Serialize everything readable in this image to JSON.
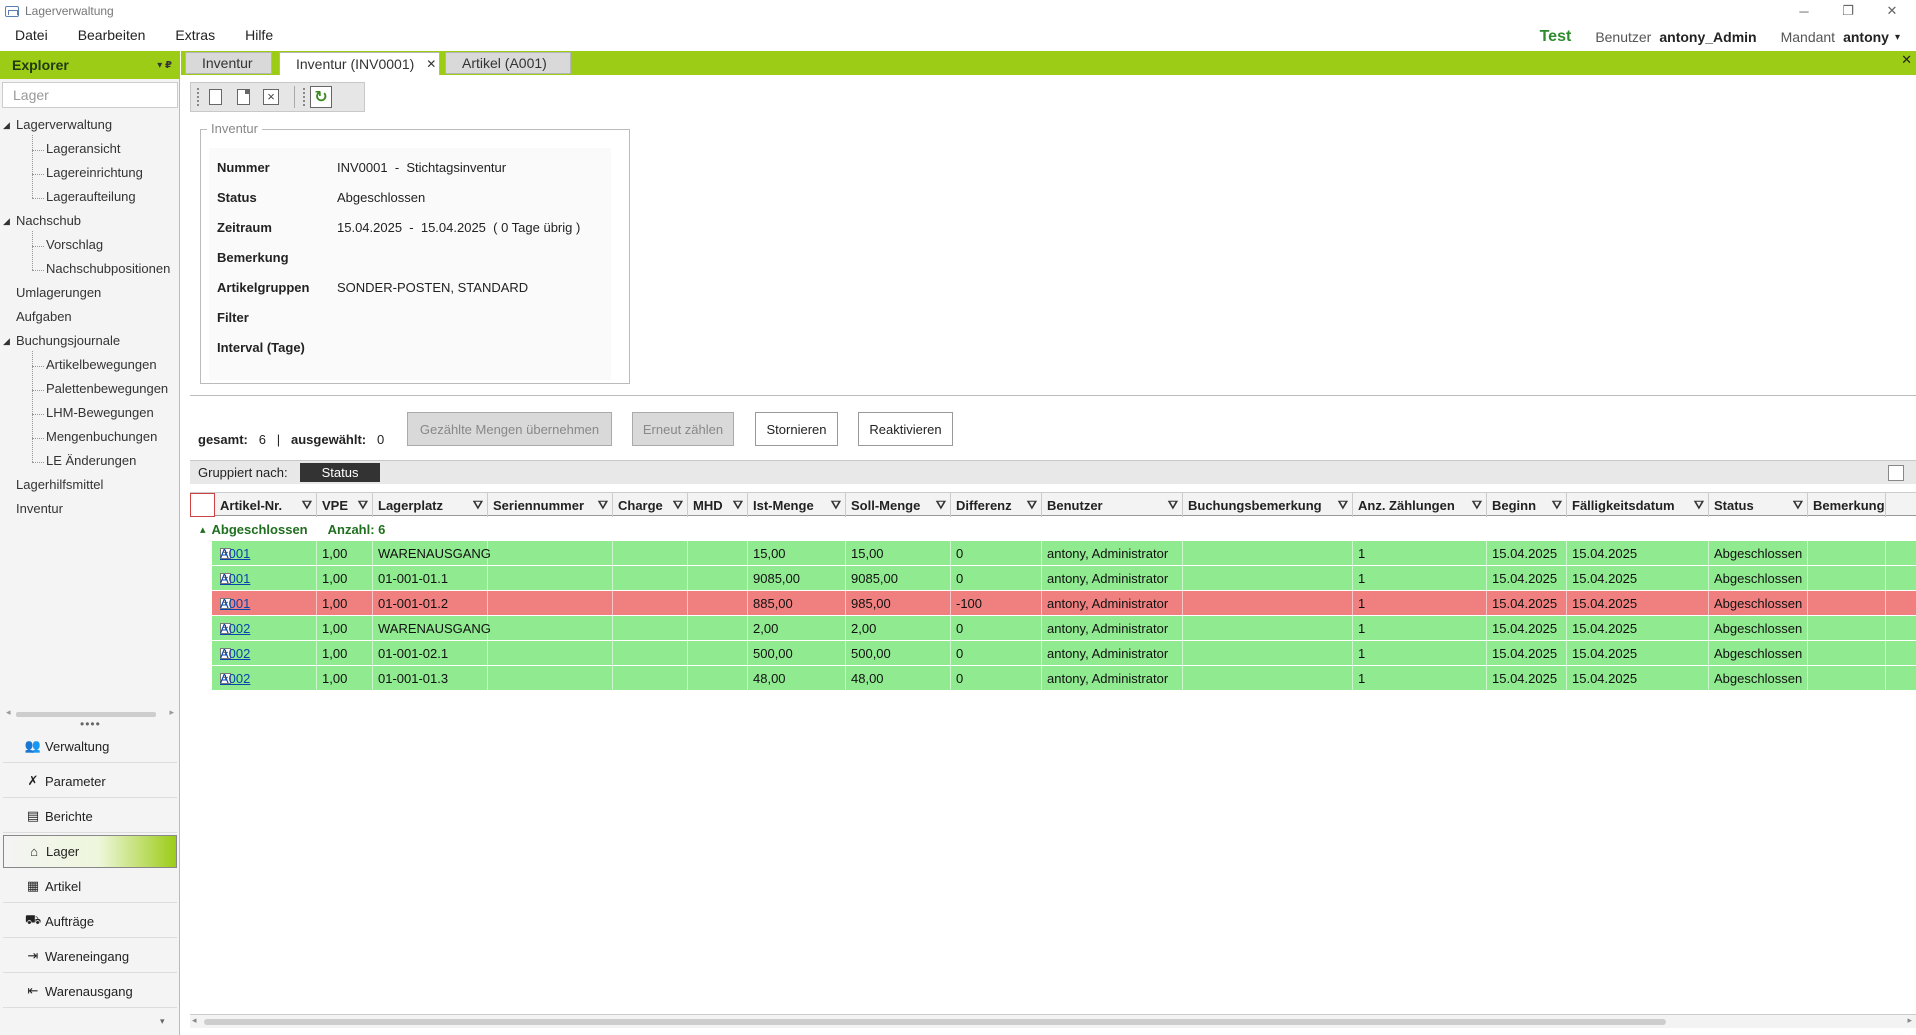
{
  "window": {
    "title": "Lagerverwaltung",
    "controls": {
      "minimize": "─",
      "restore": "❐",
      "close": "✕"
    }
  },
  "menu": {
    "items": [
      "Datei",
      "Bearbeiten",
      "Extras",
      "Hilfe"
    ],
    "environment": "Test",
    "user_label": "Benutzer",
    "user_value": "antony_Admin",
    "tenant_label": "Mandant",
    "tenant_value": "antony",
    "tenant_caret": "▾"
  },
  "tabs": [
    {
      "label": "Inventur",
      "close": ""
    },
    {
      "label": "Inventur (INV0001)",
      "close": "✕"
    },
    {
      "label": "Artikel (A001)",
      "close": ""
    }
  ],
  "tabstrip_close": "✕",
  "explorer": {
    "title": "Explorer",
    "controls": "▾  ₽",
    "section": "Lager",
    "tree": [
      {
        "label": "Lagerverwaltung",
        "level": 0,
        "expander": "◢"
      },
      {
        "label": "Lageransicht",
        "level": 1
      },
      {
        "label": "Lagereinrichtung",
        "level": 1
      },
      {
        "label": "Lageraufteilung",
        "level": 1
      },
      {
        "label": "Nachschub",
        "level": 0,
        "expander": "◢"
      },
      {
        "label": "Vorschlag",
        "level": 1
      },
      {
        "label": "Nachschubpositionen",
        "level": 1
      },
      {
        "label": "Umlagerungen",
        "level": 0
      },
      {
        "label": "Aufgaben",
        "level": 0
      },
      {
        "label": "Buchungsjournale",
        "level": 0,
        "expander": "◢"
      },
      {
        "label": "Artikelbewegungen",
        "level": 1
      },
      {
        "label": "Palettenbewegungen",
        "level": 1
      },
      {
        "label": "LHM-Bewegungen",
        "level": 1
      },
      {
        "label": "Mengenbuchungen",
        "level": 1
      },
      {
        "label": "LE Änderungen",
        "level": 1
      },
      {
        "label": "Lagerhilfsmittel",
        "level": 0
      },
      {
        "label": "Inventur",
        "level": 0
      }
    ],
    "scroll_left": "◂",
    "scroll_right": "▸",
    "splitter": "••••",
    "nav": [
      {
        "label": "Verwaltung",
        "icon": "users-icon",
        "glyph": "👥"
      },
      {
        "label": "Parameter",
        "icon": "tools-icon",
        "glyph": "✗"
      },
      {
        "label": "Berichte",
        "icon": "reports-icon",
        "glyph": "▤"
      },
      {
        "label": "Lager",
        "icon": "warehouse-icon",
        "glyph": "⌂"
      },
      {
        "label": "Artikel",
        "icon": "boxes-icon",
        "glyph": "▦"
      },
      {
        "label": "Aufträge",
        "icon": "truck-icon",
        "glyph": "⛟"
      },
      {
        "label": "Wareneingang",
        "icon": "sign-in-icon",
        "glyph": "⇥"
      },
      {
        "label": "Warenausgang",
        "icon": "sign-out-icon",
        "glyph": "⇤"
      }
    ],
    "nav_more": "▾"
  },
  "inventory": {
    "legend": "Inventur",
    "fields": [
      {
        "label": "Nummer",
        "value": "INV0001  -  Stichtagsinventur"
      },
      {
        "label": "Status",
        "value": "Abgeschlossen"
      },
      {
        "label": "Zeitraum",
        "value": "15.04.2025  -  15.04.2025  ( 0 Tage übrig )"
      },
      {
        "label": "Bemerkung",
        "value": ""
      },
      {
        "label": "Artikelgruppen",
        "value": "SONDER-POSTEN, STANDARD"
      },
      {
        "label": "Filter",
        "value": ""
      },
      {
        "label": "Interval (Tage)",
        "value": ""
      }
    ]
  },
  "counts": {
    "total_label": "gesamt:",
    "total_value": "6",
    "separator": "|",
    "selected_label": "ausgewählt:",
    "selected_value": "0"
  },
  "actions": {
    "apply": "Gezählte Mengen übernehmen",
    "recount": "Erneut zählen",
    "cancel": "Stornieren",
    "reactivate": "Reaktivieren"
  },
  "grouping": {
    "label": "Gruppiert nach:",
    "chip": "Status"
  },
  "grid": {
    "filter_glyph": "⛛",
    "columns": [
      "Artikel-Nr.",
      "VPE",
      "Lagerplatz",
      "Seriennummer",
      "Charge",
      "MHD",
      "Ist-Menge",
      "Soll-Menge",
      "Differenz",
      "Benutzer",
      "Buchungsbemerkung",
      "Anz. Zählungen",
      "Beginn",
      "Fälligkeitsdatum",
      "Status",
      "Bemerkung"
    ],
    "group": {
      "caret": "▴",
      "name": "Abgeschlossen",
      "count_label": "Anzahl: 6"
    },
    "rows": [
      {
        "state": "ok",
        "article": "A001",
        "vpe": "1,00",
        "location": "WARENAUSGANG",
        "serial": "",
        "batch": "",
        "mhd": "",
        "actual": "15,00",
        "target": "15,00",
        "diff": "0",
        "user": "antony, Administrator",
        "remark": "",
        "counts": "1",
        "start": "15.04.2025",
        "due": "15.04.2025",
        "status": "Abgeschlossen",
        "note": ""
      },
      {
        "state": "ok",
        "article": "A001",
        "vpe": "1,00",
        "location": "01-001-01.1",
        "serial": "",
        "batch": "",
        "mhd": "",
        "actual": "9085,00",
        "target": "9085,00",
        "diff": "0",
        "user": "antony, Administrator",
        "remark": "",
        "counts": "1",
        "start": "15.04.2025",
        "due": "15.04.2025",
        "status": "Abgeschlossen",
        "note": ""
      },
      {
        "state": "bad",
        "article": "A001",
        "vpe": "1,00",
        "location": "01-001-01.2",
        "serial": "",
        "batch": "",
        "mhd": "",
        "actual": "885,00",
        "target": "985,00",
        "diff": "-100",
        "user": "antony, Administrator",
        "remark": "",
        "counts": "1",
        "start": "15.04.2025",
        "due": "15.04.2025",
        "status": "Abgeschlossen",
        "note": ""
      },
      {
        "state": "ok",
        "article": "A002",
        "vpe": "1,00",
        "location": "WARENAUSGANG",
        "serial": "",
        "batch": "",
        "mhd": "",
        "actual": "2,00",
        "target": "2,00",
        "diff": "0",
        "user": "antony, Administrator",
        "remark": "",
        "counts": "1",
        "start": "15.04.2025",
        "due": "15.04.2025",
        "status": "Abgeschlossen",
        "note": ""
      },
      {
        "state": "ok",
        "article": "A002",
        "vpe": "1,00",
        "location": "01-001-02.1",
        "serial": "",
        "batch": "",
        "mhd": "",
        "actual": "500,00",
        "target": "500,00",
        "diff": "0",
        "user": "antony, Administrator",
        "remark": "",
        "counts": "1",
        "start": "15.04.2025",
        "due": "15.04.2025",
        "status": "Abgeschlossen",
        "note": ""
      },
      {
        "state": "ok",
        "article": "A002",
        "vpe": "1,00",
        "location": "01-001-01.3",
        "serial": "",
        "batch": "",
        "mhd": "",
        "actual": "48,00",
        "target": "48,00",
        "diff": "0",
        "user": "antony, Administrator",
        "remark": "",
        "counts": "1",
        "start": "15.04.2025",
        "due": "15.04.2025",
        "status": "Abgeschlossen",
        "note": ""
      }
    ],
    "expand_glyph": "+",
    "scroll_left": "◂",
    "scroll_right": "▸"
  },
  "colors": {
    "accent": "#9ccc16",
    "row_ok": "#90ea90",
    "row_bad": "#f08080",
    "link": "#0645ad"
  }
}
